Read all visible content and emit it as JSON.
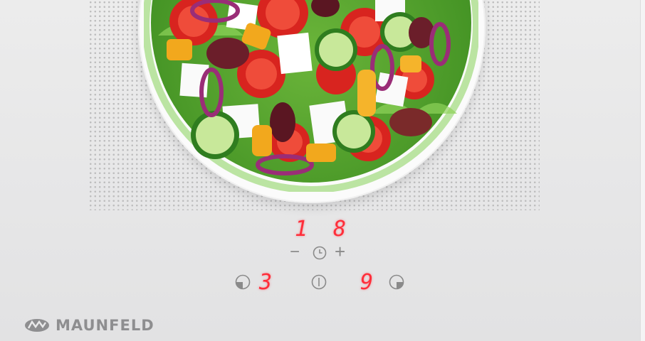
{
  "timer": {
    "display_left": "1",
    "display_right": "8",
    "minus_label": "−",
    "plus_label": "+"
  },
  "zones": {
    "left_level": "3",
    "right_level": "9"
  },
  "brand": {
    "name": "MAUNFELD"
  },
  "colors": {
    "display_red": "#ff2e3a",
    "control_gray": "#8a8a8a",
    "panel": "#e9e9ea"
  },
  "icons": {
    "timer": "clock-icon",
    "power": "power-icon",
    "left_zone": "zone-left-icon",
    "right_zone": "zone-right-icon",
    "logo": "maunfeld-logo-icon"
  }
}
